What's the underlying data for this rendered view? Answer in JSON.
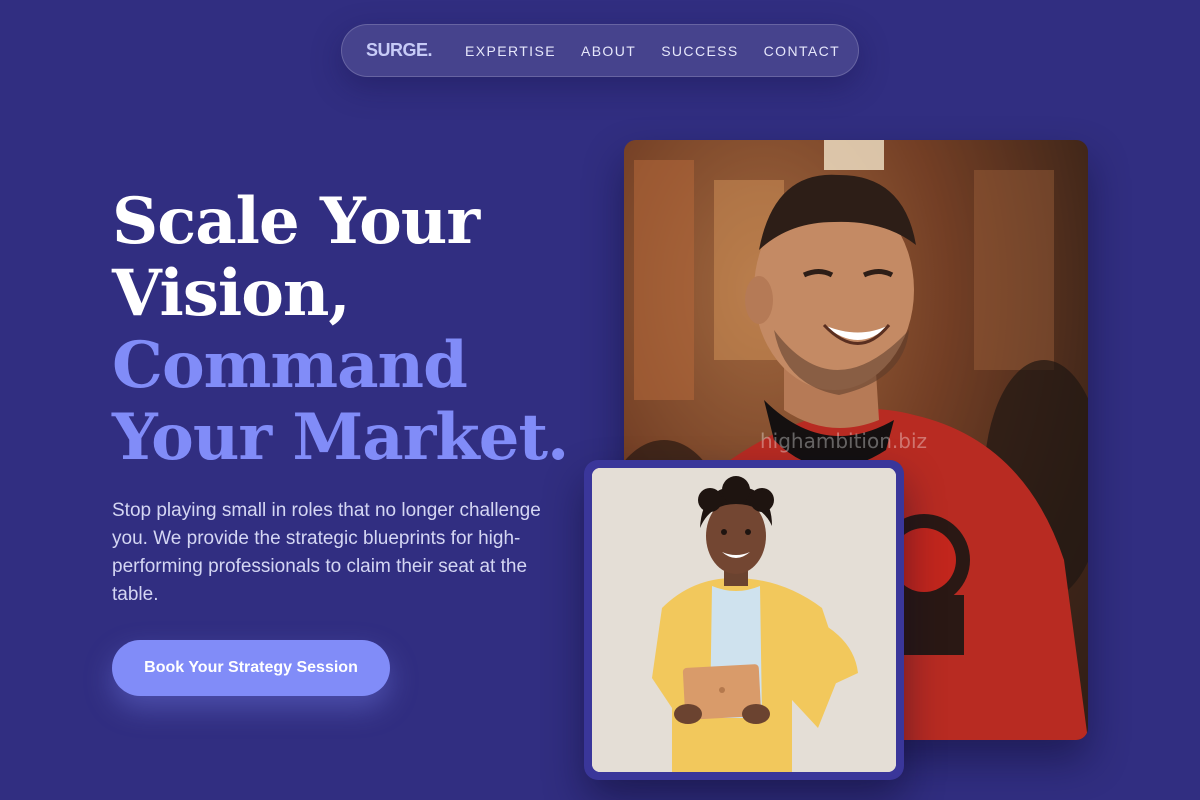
{
  "nav": {
    "brand": "SURGE.",
    "links": [
      "EXPERTISE",
      "ABOUT",
      "SUCCESS",
      "CONTACT"
    ]
  },
  "hero": {
    "headline_lines": [
      "Scale Your",
      "Vision,",
      "Command",
      "Your Market."
    ],
    "subcopy": "Stop playing small in roles that no longer challenge you. We provide the strategic blueprints for high-performing professionals to claim their seat at the table.",
    "cta_label": "Book Your Strategy Session"
  },
  "images": {
    "main_alt": "Smiling man in a red jersey",
    "small_alt": "Smiling woman in a yellow blazer holding a tablet",
    "watermark": "highambition.biz"
  },
  "colors": {
    "background": "#312e81",
    "accent": "#818cf8"
  }
}
